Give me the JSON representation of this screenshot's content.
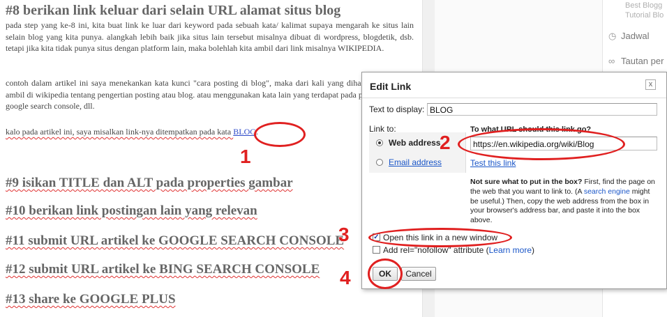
{
  "editor": {
    "heading8": "#8 berikan link keluar dari selain URL alamat situs blog",
    "para1": "pada step yang ke-8 ini, kita buat link ke luar dari keyword pada sebuah kata/ kalimat supaya mengarah ke situs lain selain blog yang kita punya. alangkah lebih baik jika situs lain tersebut misalnya dibuat di wordpress, blogdetik, dsb. tetapi jika kita tidak punya situs dengan platform lain, maka bolehlah kita ambil dari link misalnya WIKIPEDIA.",
    "para2": "contoh dalam artikel ini saya menekankan kata kunci \"cara posting di blog\", maka dari kali yang diharapkan itu saya ambil di wikipedia tentang pengertian posting atau blog. atau menggunakan kata lain yang terdapat pada postingan misal: google search console, dll.",
    "para3_prefix": "kalo pada artikel ini, saya misalkan link-nya ditempatkan pada kata ",
    "para3_link": "BLOG",
    "para3_suffix": ".",
    "heading9": "#9 isikan TITLE dan ALT pada properties gambar",
    "heading10": "#10 berikan link postingan lain yang relevan",
    "heading11": "#11 submit URL artikel ke GOOGLE SEARCH CONSOLE",
    "heading12": "#12 submit URL artikel ke BING SEARCH CONSOLE",
    "heading13": "#13 share ke GOOGLE PLUS"
  },
  "sidebar": {
    "blog1": "Best Blogg",
    "blog2": "Tutorial Blo",
    "schedule": "Jadwal",
    "links": "Tautan per"
  },
  "dialog": {
    "title": "Edit Link",
    "close": "x",
    "text_to_display_label": "Text to display:",
    "text_to_display_value": "BLOG",
    "link_to_label": "Link to:",
    "web_address": "Web address",
    "email_address": "Email address",
    "url_question": "To what URL should this link go?",
    "url_value": "https://en.wikipedia.org/wiki/Blog",
    "test_link": "Test this link",
    "help_bold": "Not sure what to put in the box?",
    "help_text1": " First, find the page on the web that you want to link to. (A ",
    "help_link": "search engine",
    "help_text2": " might be useful.) Then, copy the web address from the box in your browser's address bar, and paste it into the box above.",
    "open_new_window": "Open this link in a new window",
    "nofollow": "Add rel=\"nofollow\" attribute",
    "learn_more_open": "(",
    "learn_more": "Learn more",
    "learn_more_close": ")",
    "ok": "OK",
    "cancel": "Cancel"
  },
  "annotations": {
    "n1": "1",
    "n2": "2",
    "n3": "3",
    "n4": "4"
  },
  "colors": {
    "annotation": "#e02020",
    "link": "#2c49c8",
    "heading": "#666666"
  }
}
